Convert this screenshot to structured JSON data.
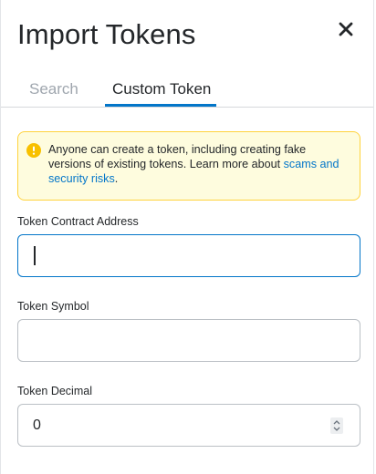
{
  "header": {
    "title": "Import Tokens",
    "close_icon": "close-icon"
  },
  "tabs": [
    {
      "label": "Search",
      "active": false
    },
    {
      "label": "Custom Token",
      "active": true
    }
  ],
  "warning": {
    "icon": "info-icon",
    "text": "Anyone can create a token, including creating fake versions of existing tokens. Learn more about ",
    "link": "scams and security risks",
    "suffix": "."
  },
  "fields": {
    "contract_address": {
      "label": "Token Contract Address",
      "value": ""
    },
    "symbol": {
      "label": "Token Symbol",
      "value": ""
    },
    "decimal": {
      "label": "Token Decimal",
      "value": "0"
    }
  },
  "colors": {
    "accent": "#0376c9",
    "warning_bg": "#fefcde",
    "warning_border": "#ffd33d",
    "muted_tab": "#9fa6ae"
  }
}
